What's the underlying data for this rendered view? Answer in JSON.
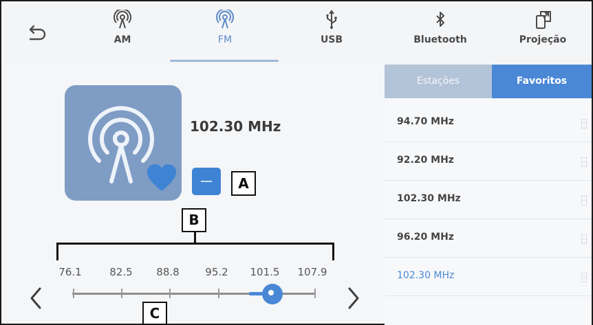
{
  "nav": {
    "back_icon": "back-arrow-icon",
    "tabs": [
      {
        "label": "AM",
        "icon": "broadcast-icon",
        "active": false
      },
      {
        "label": "FM",
        "icon": "broadcast-icon",
        "active": true
      },
      {
        "label": "USB",
        "icon": "usb-icon",
        "active": false
      },
      {
        "label": "Bluetooth",
        "icon": "bluetooth-icon",
        "active": false
      },
      {
        "label": "Projeção",
        "icon": "projection-icon",
        "active": false
      }
    ]
  },
  "now_playing": {
    "frequency": "102.30 MHz",
    "art_icon": "broadcast-icon",
    "favorite_icon": "heart-icon"
  },
  "tuner": {
    "scale": [
      "76.1",
      "82.5",
      "88.8",
      "95.2",
      "101.5",
      "107.9"
    ],
    "current_position_fraction": 0.84
  },
  "callouts": {
    "a": "A",
    "b": "B",
    "c": "C"
  },
  "list": {
    "segments": {
      "stations": "Estações",
      "favorites": "Favoritos",
      "active": "favorites"
    },
    "items": [
      "94.70 MHz",
      "92.20 MHz",
      "102.30 MHz",
      "96.20 MHz",
      "102.30 MHz"
    ],
    "current_index": 4
  },
  "colors": {
    "accent": "#4a88d6",
    "art_bg": "#7f9cc4",
    "segment_inactive": "#b3c3d8"
  }
}
